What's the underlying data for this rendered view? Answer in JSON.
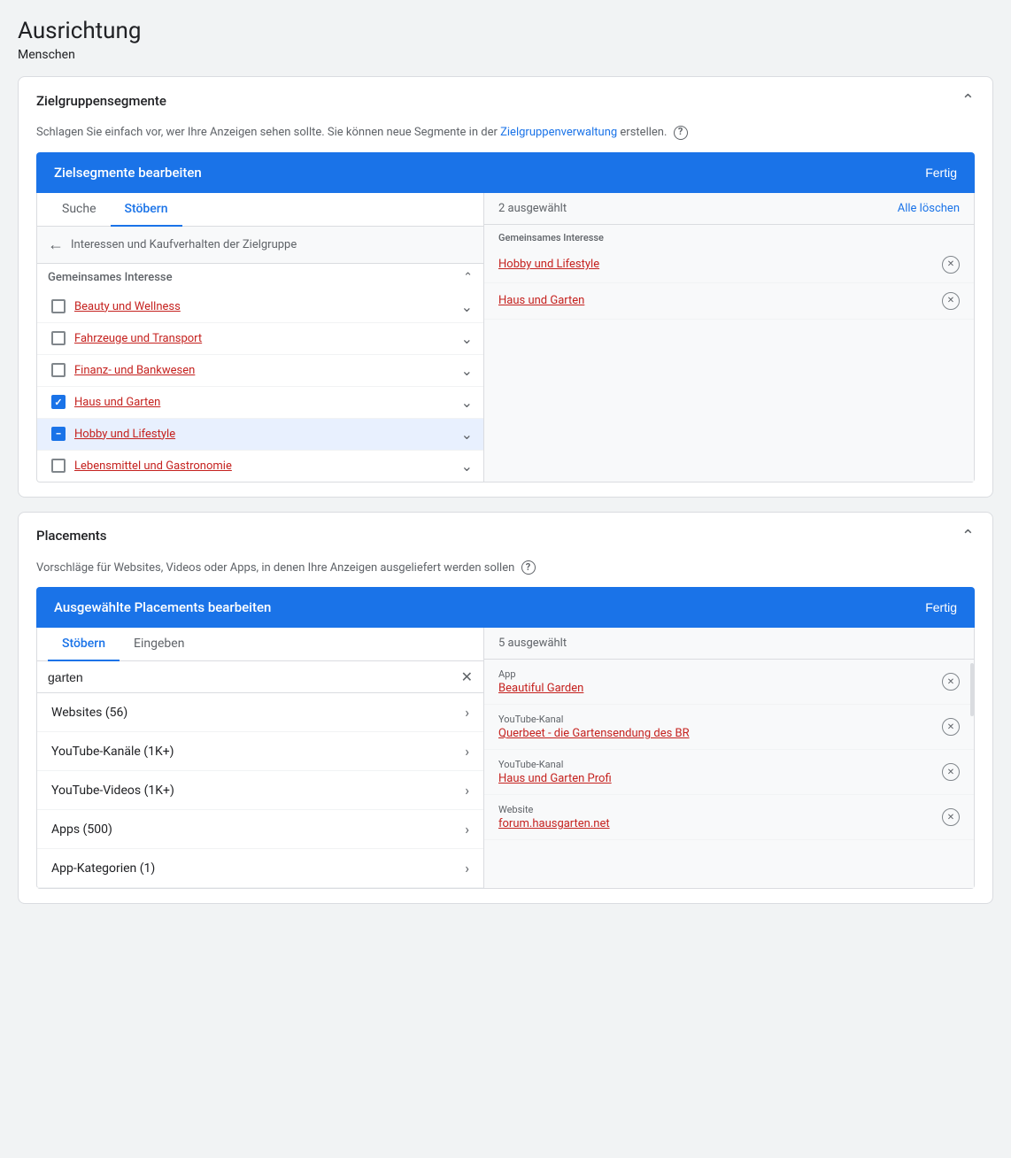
{
  "page": {
    "title": "Ausrichtung",
    "subtitle": "Menschen"
  },
  "zielgruppen": {
    "card_title": "Zielgruppensegmente",
    "description_text": "Schlagen Sie einfach vor, wer Ihre Anzeigen sehen sollte.  Sie können neue Segmente in der ",
    "description_link": "Zielgruppenverwaltung",
    "description_end": " erstellen.",
    "edit_header": "Zielsegmente bearbeiten",
    "fertig_label": "Fertig",
    "tab_suche": "Suche",
    "tab_stoebern": "Stöbern",
    "selected_count": "2 ausgewählt",
    "clear_all": "Alle löschen",
    "breadcrumb": "Interessen und Kaufverhalten der Zielgruppe",
    "section_label_left": "Gemeinsames Interesse",
    "section_label_right": "Gemeinsames Interesse",
    "categories": [
      {
        "id": "beauty",
        "label": "Beauty und Wellness",
        "checked": false,
        "partial": false
      },
      {
        "id": "fahrzeuge",
        "label": "Fahrzeuge und Transport",
        "checked": false,
        "partial": false
      },
      {
        "id": "finanz",
        "label": "Finanz- und Bankwesen",
        "checked": false,
        "partial": false
      },
      {
        "id": "haus",
        "label": "Haus und Garten",
        "checked": true,
        "partial": false
      },
      {
        "id": "hobby",
        "label": "Hobby und Lifestyle",
        "checked": true,
        "partial": true
      },
      {
        "id": "lebensmittel",
        "label": "Lebensmittel und Gastronomie",
        "checked": false,
        "partial": false
      }
    ],
    "selected_items": [
      {
        "label": "Hobby und Lifestyle"
      },
      {
        "label": "Haus und Garten"
      }
    ]
  },
  "placements": {
    "card_title": "Placements",
    "description": "Vorschläge für Websites, Videos oder Apps, in denen Ihre Anzeigen ausgeliefert werden sollen",
    "edit_header": "Ausgewählte Placements bearbeiten",
    "fertig_label": "Fertig",
    "tab_stoebern": "Stöbern",
    "tab_eingeben": "Eingeben",
    "selected_count": "5 ausgewählt",
    "search_value": "garten",
    "placement_rows": [
      {
        "label": "Websites (56)"
      },
      {
        "label": "YouTube-Kanäle (1K+)"
      },
      {
        "label": "YouTube-Videos (1K+)"
      },
      {
        "label": "Apps (500)"
      },
      {
        "label": "App-Kategorien (1)"
      }
    ],
    "selected_placements": [
      {
        "type": "App",
        "name": "Beautiful Garden"
      },
      {
        "type": "YouTube-Kanal",
        "name": "Querbeet - die Gartensendung des BR"
      },
      {
        "type": "YouTube-Kanal",
        "name": "Haus und Garten Profi"
      },
      {
        "type": "Website",
        "name": "forum.hausgarten.net"
      }
    ]
  }
}
